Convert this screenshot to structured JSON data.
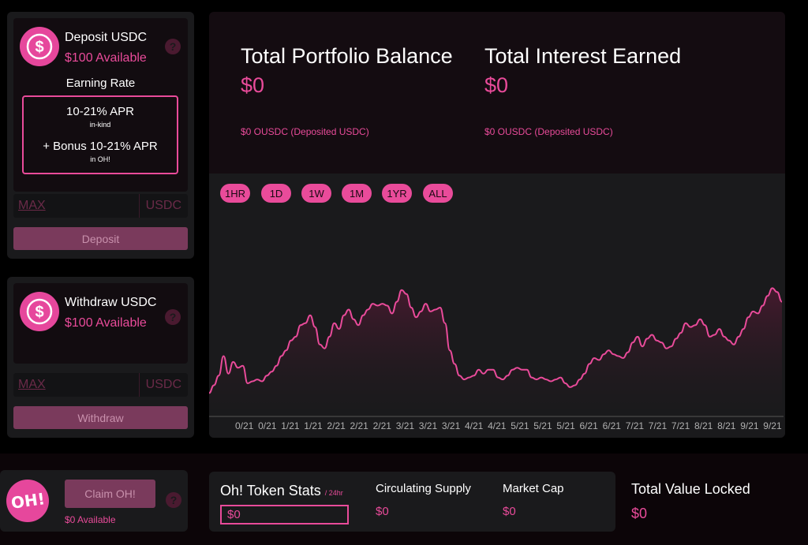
{
  "deposit": {
    "title": "Deposit USDC",
    "available": "$100 Available",
    "earning_rate_label": "Earning Rate",
    "apr_main": "10-21% APR",
    "apr_main_sub": "in-kind",
    "apr_bonus": "+ Bonus 10-21% APR",
    "apr_bonus_sub": "in OH!",
    "max_label": "MAX",
    "unit_label": "USDC",
    "button_label": "Deposit"
  },
  "withdraw": {
    "title": "Withdraw USDC",
    "available": "$100 Available",
    "max_label": "MAX",
    "unit_label": "USDC",
    "button_label": "Withdraw"
  },
  "help_glyph": "?",
  "usdc_glyph": "$",
  "portfolio": {
    "balance_label": "Total Portfolio Balance",
    "balance_value": "$0",
    "balance_sub": "$0 OUSDC (Deposited USDC)",
    "interest_label": "Total Interest Earned",
    "interest_value": "$0",
    "interest_sub": "$0 OUSDC (Deposited USDC)"
  },
  "time_ranges": [
    "1HR",
    "1D",
    "1W",
    "1M",
    "1YR",
    "ALL"
  ],
  "chart_data": {
    "type": "area",
    "x_ticks": [
      "0/21",
      "0/21",
      "1/21",
      "1/21",
      "2/21",
      "2/21",
      "2/21",
      "3/21",
      "3/21",
      "3/21",
      "4/21",
      "4/21",
      "5/21",
      "5/21",
      "5/21",
      "6/21",
      "6/21",
      "7/21",
      "7/21",
      "7/21",
      "8/21",
      "8/21",
      "9/21",
      "9/21"
    ],
    "values": [
      8,
      12,
      17,
      27,
      18,
      24,
      21,
      22,
      13,
      14,
      15,
      14,
      17,
      19,
      22,
      27,
      30,
      35,
      37,
      43,
      44,
      48,
      42,
      33,
      31,
      37,
      44,
      41,
      48,
      51,
      46,
      43,
      48,
      51,
      54,
      53,
      54,
      53,
      49,
      55,
      61,
      59,
      52,
      47,
      50,
      54,
      50,
      51,
      52,
      44,
      30,
      23,
      17,
      15,
      16,
      17,
      20,
      18,
      20,
      20,
      16,
      15,
      17,
      20,
      21,
      20,
      20,
      16,
      15,
      16,
      15,
      14,
      15,
      16,
      13,
      11,
      12,
      15,
      18,
      23,
      26,
      25,
      28,
      30,
      28,
      27,
      26,
      29,
      34,
      37,
      32,
      36,
      38,
      35,
      34,
      31,
      32,
      36,
      39,
      44,
      42,
      43,
      46,
      43,
      37,
      38,
      41,
      37,
      35,
      33,
      37,
      41,
      47,
      50,
      49,
      53,
      58,
      62,
      60,
      55
    ]
  },
  "claim": {
    "logo_text": "OH!",
    "button_label": "Claim OH!",
    "available": "$0 Available"
  },
  "token_stats": {
    "title": "Oh! Token Stats",
    "period": "/ 24hr",
    "price_value": "$0",
    "circ_label": "Circulating Supply",
    "circ_value": "$0",
    "mcap_label": "Market Cap",
    "mcap_value": "$0",
    "tvl_label": "Total Value Locked",
    "tvl_value": "$0"
  },
  "colors": {
    "accent": "#e94b9a",
    "panel": "#1a1a1c",
    "background": "#000000"
  }
}
